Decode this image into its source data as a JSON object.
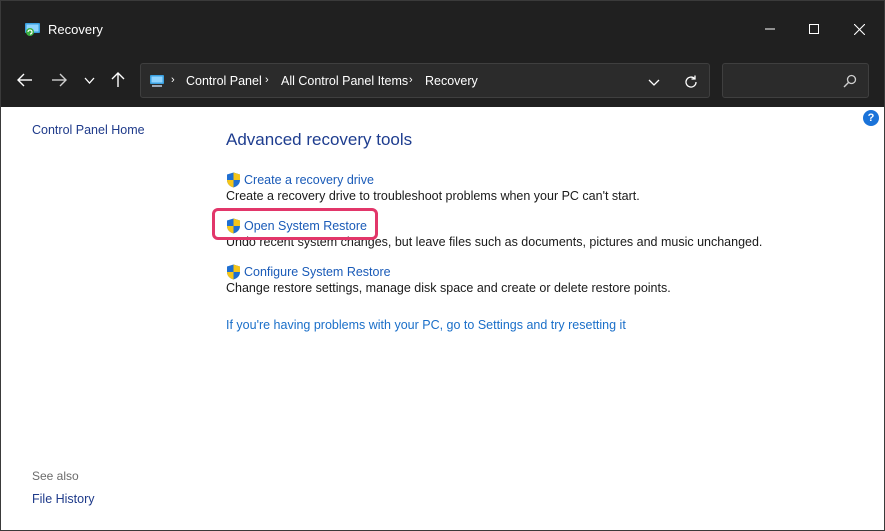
{
  "window": {
    "title": "Recovery"
  },
  "address_bar": {
    "crumbs": [
      "Control Panel",
      "All Control Panel Items",
      "Recovery"
    ],
    "separator": "›"
  },
  "search": {
    "placeholder": ""
  },
  "sidebar": {
    "home_label": "Control Panel Home",
    "see_also_label": "See also",
    "file_history_label": "File History"
  },
  "main": {
    "heading": "Advanced recovery tools",
    "tools": [
      {
        "label": "Create a recovery drive",
        "description": "Create a recovery drive to troubleshoot problems when your PC can't start."
      },
      {
        "label": "Open System Restore",
        "description": "Undo recent system changes, but leave files such as documents, pictures and music unchanged."
      },
      {
        "label": "Configure System Restore",
        "description": "Change restore settings, manage disk space and create or delete restore points."
      }
    ],
    "reset_link": "If you're having problems with your PC, go to Settings and try resetting it"
  },
  "help": {
    "label": "?"
  },
  "colors": {
    "titlebar_bg": "#202020",
    "link": "#1a5bb8",
    "highlight": "#e2366a"
  }
}
